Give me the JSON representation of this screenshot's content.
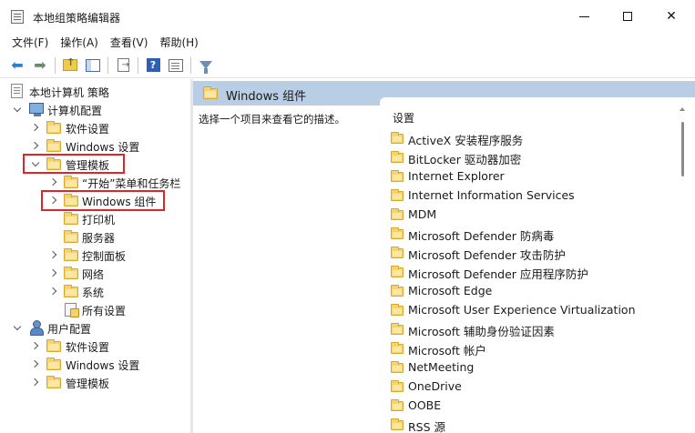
{
  "window": {
    "title": "本地组策略编辑器"
  },
  "menu": {
    "items": [
      "文件(F)",
      "操作(A)",
      "查看(V)",
      "帮助(H)"
    ]
  },
  "tree": {
    "root": "本地计算机 策略",
    "computer_config": "计算机配置",
    "software_settings": "软件设置",
    "windows_settings": "Windows 设置",
    "admin_templates": "管理模板",
    "start_menu": "“开始”菜单和任务栏",
    "windows_components": "Windows 组件",
    "printers": "打印机",
    "servers": "服务器",
    "control_panel": "控制面板",
    "network": "网络",
    "system": "系统",
    "all_settings": "所有设置",
    "user_config": "用户配置",
    "user_software_settings": "软件设置",
    "user_windows_settings": "Windows 设置",
    "user_admin_templates": "管理模板"
  },
  "detail": {
    "title": "Windows 组件",
    "description": "选择一个项目来查看它的描述。",
    "column_header": "设置",
    "items": [
      "ActiveX 安装程序服务",
      "BitLocker 驱动器加密",
      "Internet Explorer",
      "Internet Information Services",
      "MDM",
      "Microsoft Defender 防病毒",
      "Microsoft Defender 攻击防护",
      "Microsoft Defender 应用程序防护",
      "Microsoft Edge",
      "Microsoft User Experience Virtualization",
      "Microsoft 辅助身份验证因素",
      "Microsoft 帐户",
      "NetMeeting",
      "OneDrive",
      "OOBE",
      "RSS 源"
    ]
  },
  "colors": {
    "highlight_box": "#e0242c",
    "header_bg": "#b9cde4",
    "folder": "#f6d36b"
  }
}
